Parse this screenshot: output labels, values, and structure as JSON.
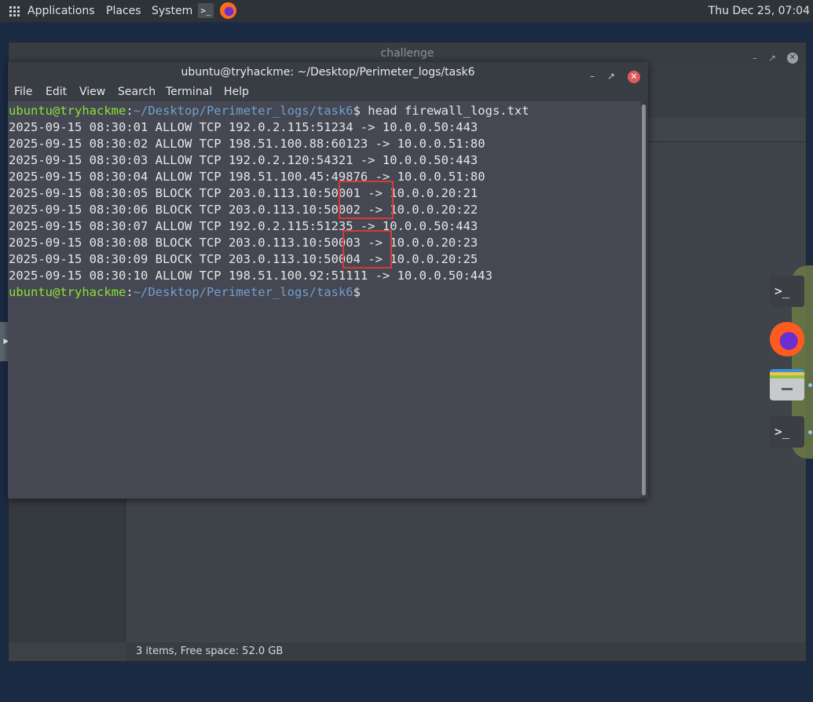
{
  "top_panel": {
    "applications": "Applications",
    "places": "Places",
    "system": "System",
    "clock": "Thu Dec 25, 07:04"
  },
  "bg_window": {
    "title": "challenge",
    "status": "3 items, Free space: 52.0 GB"
  },
  "terminal": {
    "title": "ubuntu@tryhackme: ~/Desktop/Perimeter_logs/task6",
    "menu": [
      "File",
      "Edit",
      "View",
      "Search",
      "Terminal",
      "Help"
    ],
    "prompt_user": "ubuntu@tryhackme",
    "prompt_sep": ":",
    "prompt_path": "~/Desktop/Perimeter_logs/task6",
    "prompt_end": "$",
    "command": " head firewall_logs.txt",
    "log_lines": [
      "2025-09-15 08:30:01 ALLOW TCP 192.0.2.115:51234 -> 10.0.0.50:443",
      "2025-09-15 08:30:02 ALLOW TCP 198.51.100.88:60123 -> 10.0.0.51:80",
      "2025-09-15 08:30:03 ALLOW TCP 192.0.2.120:54321 -> 10.0.0.50:443",
      "2025-09-15 08:30:04 ALLOW TCP 198.51.100.45:49876 -> 10.0.0.51:80",
      "2025-09-15 08:30:05 BLOCK TCP 203.0.113.10:50001 -> 10.0.0.20:21",
      "2025-09-15 08:30:06 BLOCK TCP 203.0.113.10:50002 -> 10.0.0.20:22",
      "2025-09-15 08:30:07 ALLOW TCP 192.0.2.115:51235 -> 10.0.0.50:443",
      "2025-09-15 08:30:08 BLOCK TCP 203.0.113.10:50003 -> 10.0.0.20:23",
      "2025-09-15 08:30:09 BLOCK TCP 203.0.113.10:50004 -> 10.0.0.20:25",
      "2025-09-15 08:30:10 ALLOW TCP 198.51.100.92:51111 -> 10.0.0.50:443"
    ]
  },
  "launcher": {
    "terminal_glyph": ">_"
  },
  "dock": {
    "terminal_glyph": ">_"
  },
  "colors": {
    "prompt_user": "#8ae234",
    "prompt_path": "#729fcf",
    "highlight": "#d83a3a",
    "close_button": "#e05a5a"
  }
}
